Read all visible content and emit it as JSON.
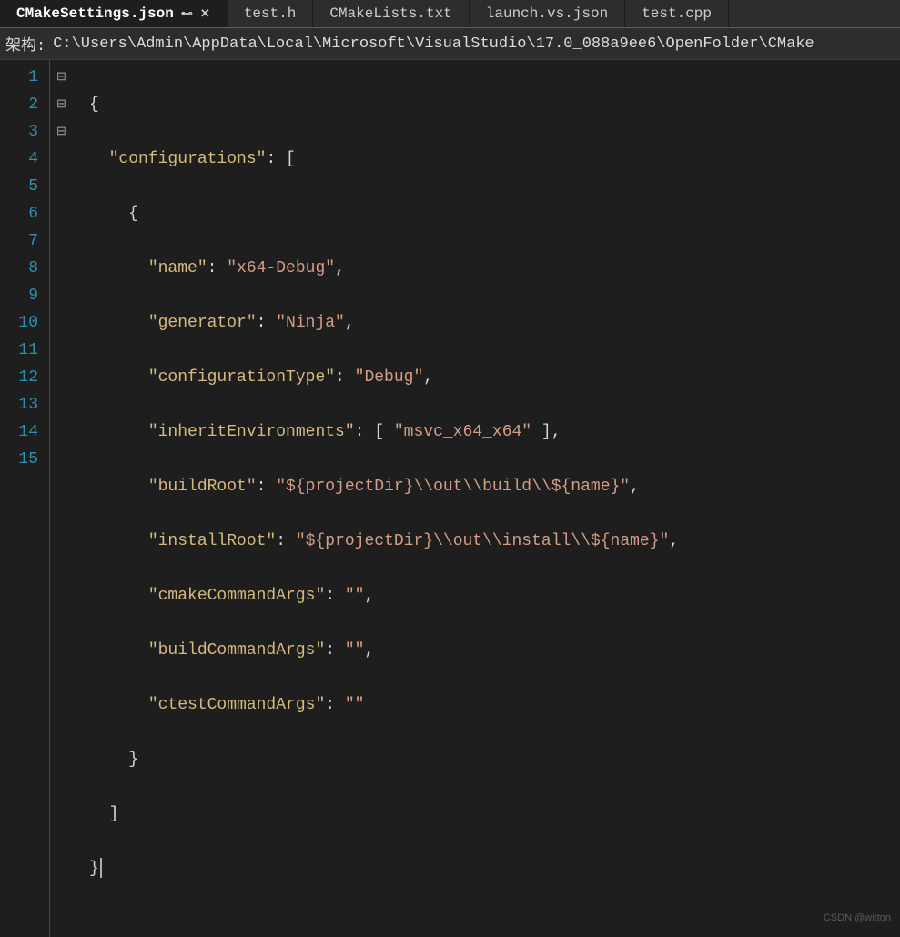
{
  "tabs": [
    {
      "label": "CMakeSettings.json",
      "active": true,
      "pinned": true
    },
    {
      "label": "test.h",
      "active": false
    },
    {
      "label": "CMakeLists.txt",
      "active": false
    },
    {
      "label": "launch.vs.json",
      "active": false
    },
    {
      "label": "test.cpp",
      "active": false
    }
  ],
  "pathbar": {
    "label": "架构:",
    "value": "C:\\Users\\Admin\\AppData\\Local\\Microsoft\\VisualStudio\\17.0_088a9ee6\\OpenFolder\\CMake"
  },
  "lines": [
    "1",
    "2",
    "3",
    "4",
    "5",
    "6",
    "7",
    "8",
    "9",
    "10",
    "11",
    "12",
    "13",
    "14",
    "15"
  ],
  "fold": [
    "⊟",
    "⊟",
    "⊟",
    "",
    "",
    "",
    "",
    "",
    "",
    "",
    "",
    "",
    "",
    "",
    ""
  ],
  "code": {
    "l1": "{",
    "l2_key": "\"configurations\"",
    "l2_b": ": [",
    "l3": "{",
    "l4_k": "\"name\"",
    "l4_v": "\"x64-Debug\"",
    "l5_k": "\"generator\"",
    "l5_v": "\"Ninja\"",
    "l6_k": "\"configurationType\"",
    "l6_v": "\"Debug\"",
    "l7_k": "\"inheritEnvironments\"",
    "l7_v": "\"msvc_x64_x64\"",
    "l8_k": "\"buildRoot\"",
    "l8_v": "\"${projectDir}\\\\out\\\\build\\\\${name}\"",
    "l9_k": "\"installRoot\"",
    "l9_v": "\"${projectDir}\\\\out\\\\install\\\\${name}\"",
    "l10_k": "\"cmakeCommandArgs\"",
    "l10_v": "\"\"",
    "l11_k": "\"buildCommandArgs\"",
    "l11_v": "\"\"",
    "l12_k": "\"ctestCommandArgs\"",
    "l12_v": "\"\"",
    "l13": "}",
    "l14": "]",
    "l15": "}"
  },
  "watermark": "CSDN @witton",
  "chart_data": null
}
